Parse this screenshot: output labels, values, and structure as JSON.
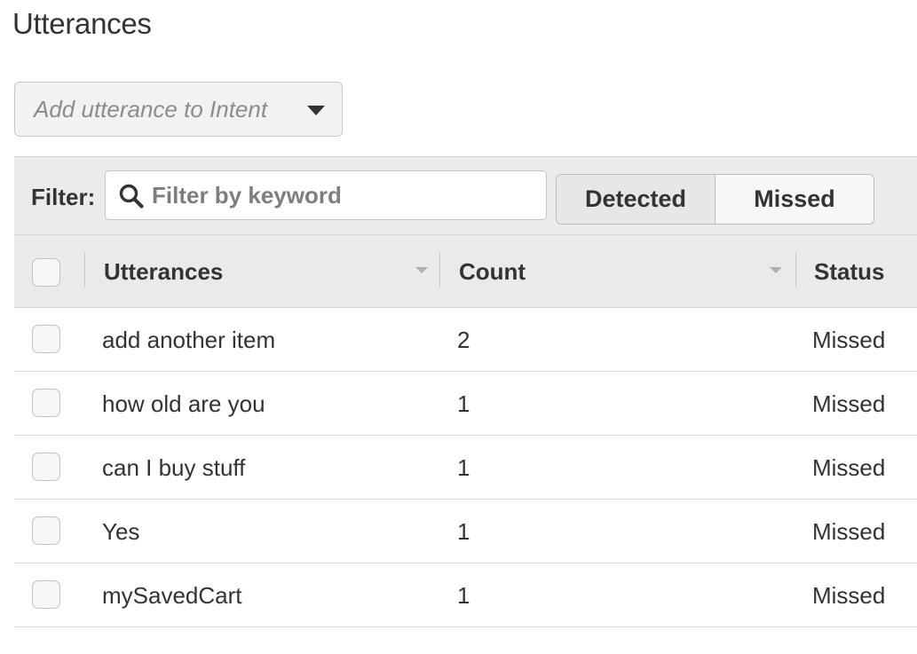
{
  "page": {
    "title": "Utterances"
  },
  "add_utterance": {
    "placeholder": "Add utterance to Intent"
  },
  "filter": {
    "label": "Filter:",
    "placeholder": "Filter by keyword",
    "value": ""
  },
  "toggle": {
    "options": [
      "Detected",
      "Missed"
    ],
    "selected": "Missed"
  },
  "table": {
    "columns": [
      "Utterances",
      "Count",
      "Status"
    ],
    "rows": [
      {
        "utterance": "add another item",
        "count": "2",
        "status": "Missed"
      },
      {
        "utterance": "how old are you",
        "count": "1",
        "status": "Missed"
      },
      {
        "utterance": "can I buy stuff",
        "count": "1",
        "status": "Missed"
      },
      {
        "utterance": "Yes",
        "count": "1",
        "status": "Missed"
      },
      {
        "utterance": "mySavedCart",
        "count": "1",
        "status": "Missed"
      }
    ]
  },
  "icons": {
    "filter": "search-icon",
    "add_dropdown": "caret-down-icon",
    "sort": "sort-caret-icon"
  },
  "colors": {
    "toolbar_bg": "#ebebeb",
    "header_bg": "#eaeaea",
    "text": "#333333",
    "placeholder": "#8c8c8c"
  }
}
